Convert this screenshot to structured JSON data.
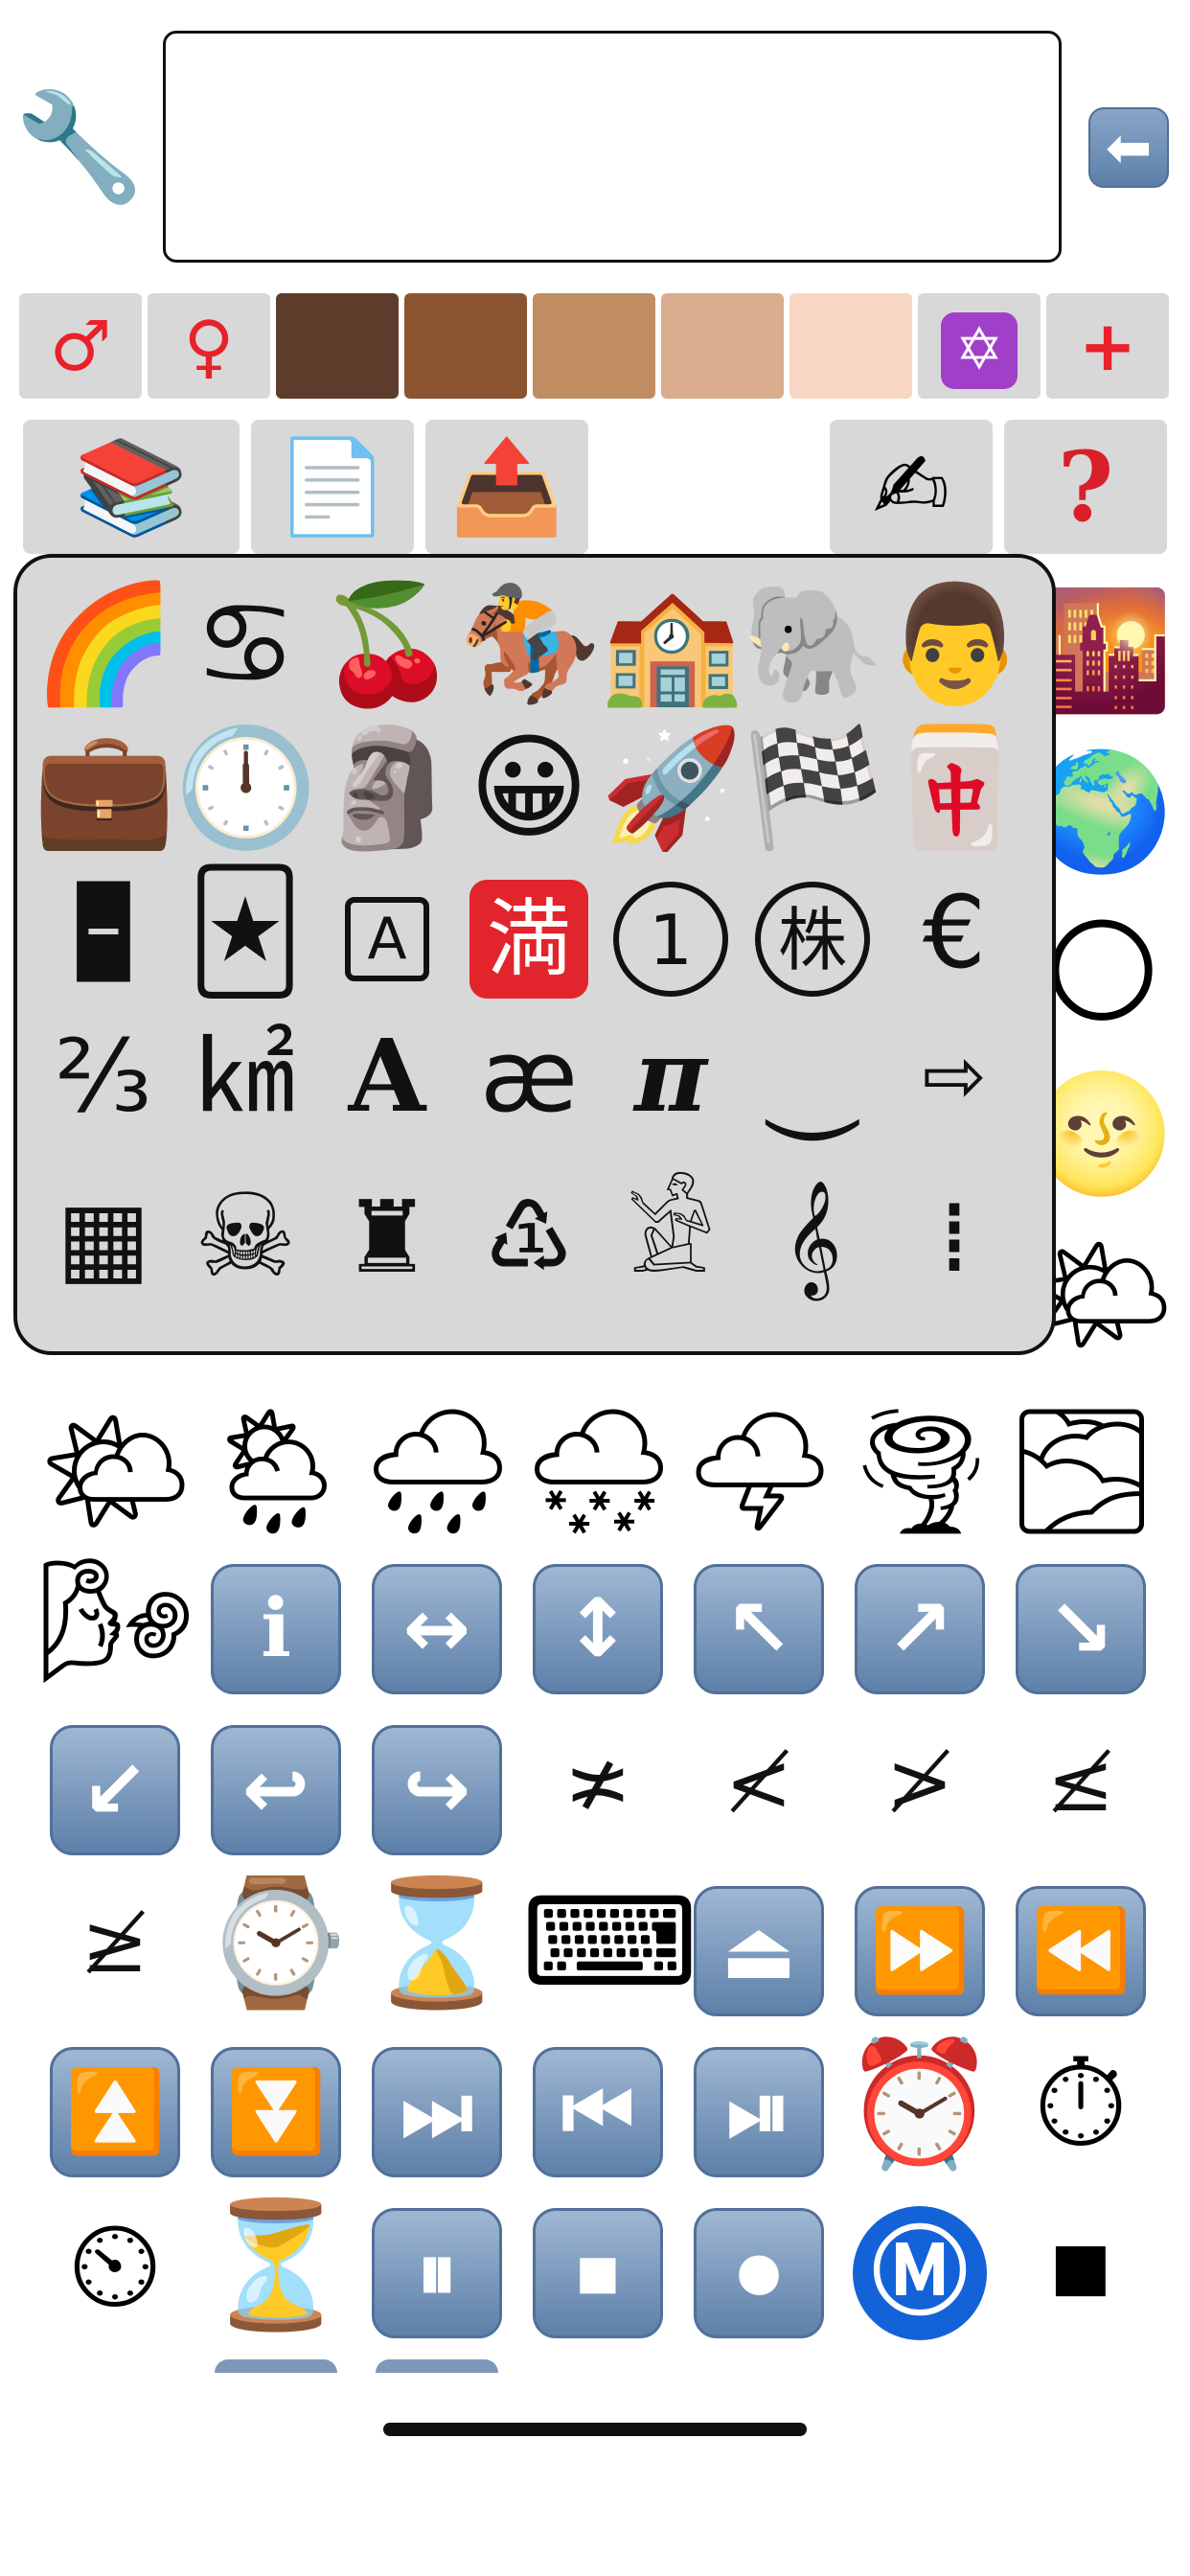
{
  "toolbar": {
    "settings_icon": "🔧",
    "backspace_icon": "⬅",
    "input_value": ""
  },
  "modifiers": {
    "male": "♂",
    "female": "♀",
    "skin_tones": [
      "#5e3c2c",
      "#8c5531",
      "#bf8d61",
      "#d9ad8e",
      "#f7d6c3"
    ],
    "star_of_david": "✡",
    "plus": "+"
  },
  "tools": {
    "books": "📚",
    "copy": "📄",
    "share": "📤",
    "write": "✍",
    "help": "?"
  },
  "popup": {
    "rows": [
      [
        "🌈",
        "♋",
        "🍒",
        "🏇",
        "🏫",
        "🐘",
        "👨"
      ],
      [
        "💼",
        "🕛",
        "🗿",
        "😀",
        "🚀",
        "🏁",
        "🀄"
      ],
      [
        "🁢",
        "🃏",
        "A",
        "満",
        "1",
        "株",
        "€"
      ],
      [
        "⅔",
        "㎢",
        "𝐀",
        "æ",
        "π",
        "⏝",
        "⇨"
      ],
      [
        "▦",
        "☠",
        "♜",
        "♳",
        "𓀀",
        "𝄞",
        "⁞"
      ]
    ]
  },
  "grid": {
    "side_col": [
      "🌇",
      "🌍",
      "🌕",
      "🌝",
      "🌤"
    ],
    "rows": [
      [
        "🌤",
        "🌦",
        "🌧",
        "🌨",
        "🌩",
        "🌪",
        "🌫"
      ],
      [
        "🌬",
        "ℹ",
        "↔",
        "↕",
        "↖",
        "↗",
        "↘"
      ],
      [
        "↙",
        "↩",
        "↪",
        "≭",
        "≮",
        "≯",
        "≰"
      ],
      [
        "≱",
        "⌚",
        "⌛",
        "⌨",
        "⏏",
        "⏩",
        "⏪"
      ],
      [
        "⏫",
        "⏬",
        "⏭",
        "⏮",
        "⏯",
        "⏰",
        "⏱"
      ],
      [
        "⏲",
        "⏳",
        "⏸",
        "⏹",
        "⏺",
        "Ⓜ",
        "◼"
      ]
    ]
  }
}
